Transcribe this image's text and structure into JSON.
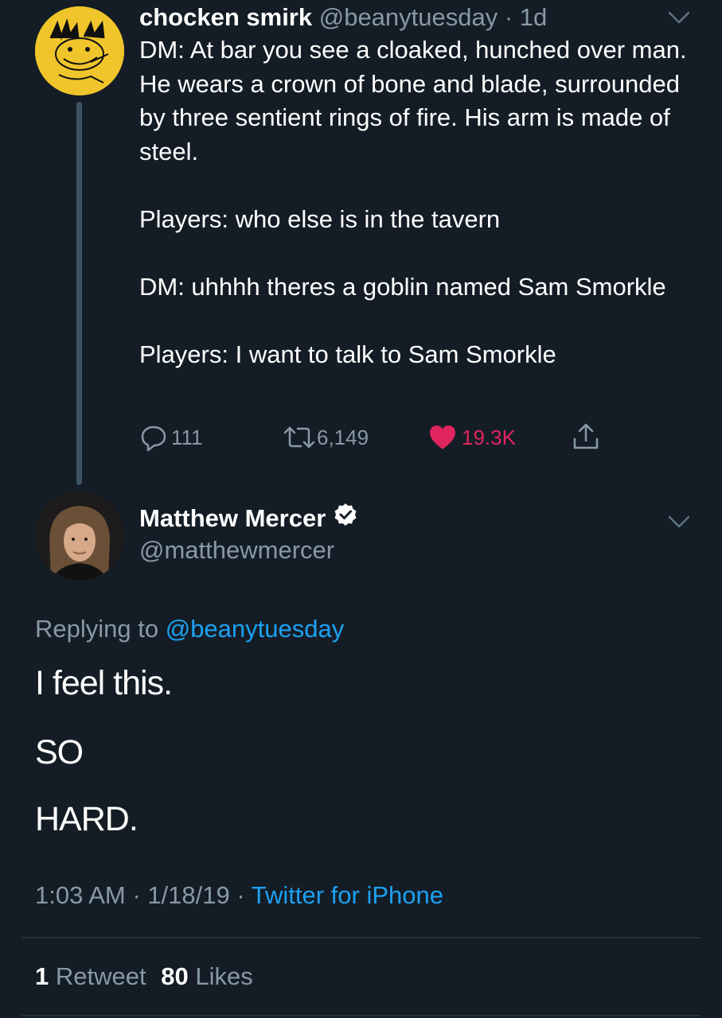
{
  "parent_tweet": {
    "name": "chocken smirk",
    "handle": "@beanytuesday",
    "time": "1d",
    "paragraphs": [
      "DM: At bar you see a cloaked, hunched over man. He wears a crown of bone and blade, surrounded by three sentient rings of fire. His arm is made of steel.",
      "Players: who else is in the tavern",
      "DM: uhhhh theres a goblin named Sam Smorkle",
      "Players: I want to talk to Sam Smorkle"
    ],
    "reply_count": "111",
    "retweet_count": "6,149",
    "like_count": "19.3K",
    "liked": true
  },
  "reply_tweet": {
    "name": "Matthew Mercer",
    "verified": true,
    "handle": "@matthewmercer",
    "replying_to_label": "Replying to",
    "replying_to_handle": "@beanytuesday",
    "lines": [
      "I feel this.",
      "SO",
      "HARD."
    ],
    "time": "1:03 AM",
    "date": "1/18/19",
    "source": "Twitter for iPhone",
    "retweets_count": "1",
    "retweets_label": "Retweet",
    "likes_count": "80",
    "likes_label": "Likes"
  },
  "colors": {
    "background": "#141d26",
    "secondary_text": "#8899a6",
    "link": "#1da1f2",
    "like": "#e0245e",
    "thread_line": "#3d5466"
  },
  "icons": [
    "reply-icon",
    "retweet-icon",
    "heart-icon",
    "share-icon",
    "chevron-down-icon",
    "verified-badge-icon"
  ]
}
